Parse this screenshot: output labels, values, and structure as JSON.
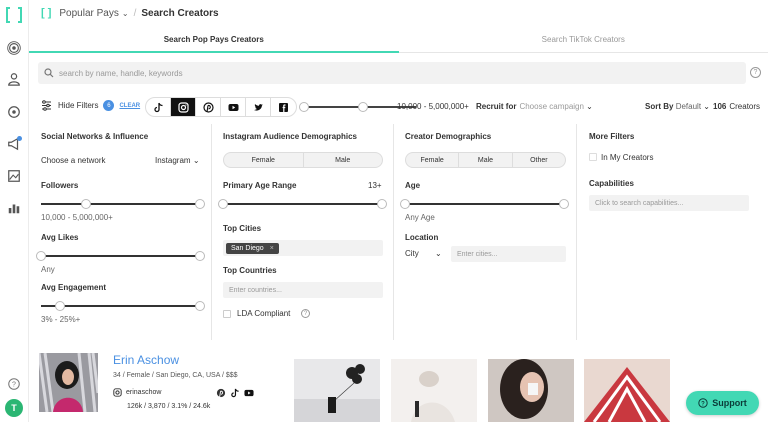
{
  "breadcrumb": {
    "section": "Popular Pays",
    "page": "Search Creators"
  },
  "tabs": [
    {
      "label": "Search Pop Pays Creators",
      "active": true
    },
    {
      "label": "Search TikTok Creators",
      "active": false
    }
  ],
  "search": {
    "placeholder": "search by name, handle, keywords"
  },
  "toolbar": {
    "hide_filters": "Hide Filters",
    "filter_count": "6",
    "clear": "CLEAR",
    "networks": [
      "tiktok-icon",
      "instagram-icon",
      "pinterest-icon",
      "youtube-icon",
      "twitter-icon",
      "facebook-icon"
    ],
    "active_network": "instagram-icon",
    "follower_range": "10,000 - 5,000,000+",
    "recruit_label": "Recruit for",
    "recruit_placeholder": "Choose campaign",
    "sort_label": "Sort By",
    "sort_value": "Default",
    "creator_count": "106",
    "creator_count_label": "Creators"
  },
  "filters": {
    "social": {
      "title": "Social Networks & Influence",
      "network_label": "Choose a network",
      "network_value": "Instagram",
      "followers_label": "Followers",
      "followers_value": "10,000 - 5,000,000+",
      "likes_label": "Avg Likes",
      "likes_value": "Any",
      "engagement_label": "Avg Engagement",
      "engagement_value": "3% - 25%+"
    },
    "audience": {
      "title": "Instagram Audience Demographics",
      "genders": [
        "Female",
        "Male"
      ],
      "age_label": "Primary Age Range",
      "age_value": "13+",
      "cities_label": "Top Cities",
      "city_chip": "San Diego",
      "countries_label": "Top Countries",
      "countries_placeholder": "Enter countries...",
      "lda_label": "LDA Compliant"
    },
    "creator": {
      "title": "Creator Demographics",
      "genders": [
        "Female",
        "Male",
        "Other"
      ],
      "age_label": "Age",
      "age_value": "Any Age",
      "location_label": "Location",
      "location_type": "City",
      "location_placeholder": "Enter cities..."
    },
    "more": {
      "title": "More Filters",
      "in_my_creators": "In My Creators",
      "capabilities_label": "Capabilities",
      "capabilities_placeholder": "Click to search capabilities..."
    }
  },
  "creator_card": {
    "name": "Erin Aschow",
    "meta": "34 / Female / San Diego, CA, USA / $$$",
    "handle": "erinaschow",
    "stats": "126k / 3,870 / 3.1% / 24.6k"
  },
  "support": {
    "label": "Support"
  },
  "user_initial": "T",
  "colors": {
    "accent": "#42d8b4",
    "link": "#4a90e2"
  }
}
